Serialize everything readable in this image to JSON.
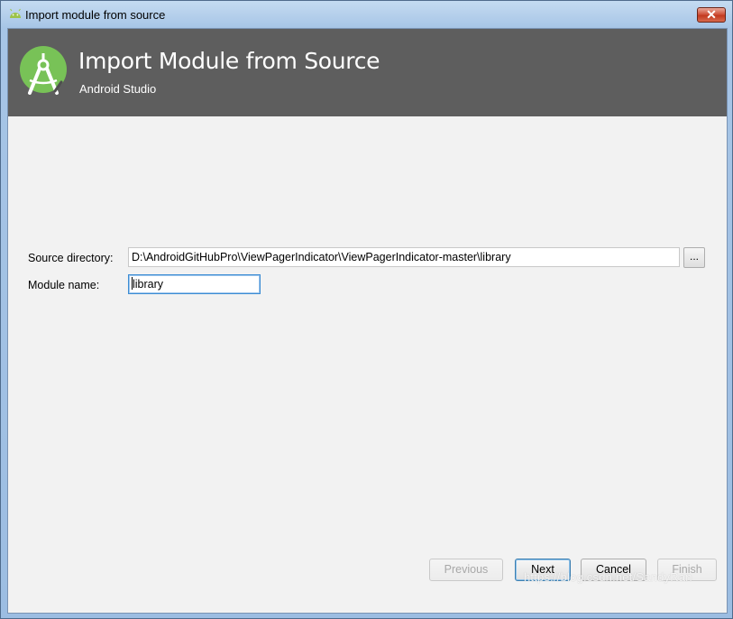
{
  "window": {
    "title": "Import module from source",
    "close_glyph": "✕"
  },
  "header": {
    "title": "Import Module from Source",
    "subtitle": "Android Studio",
    "logo_icon": "android-studio-icon",
    "header_bg": "#5e5e5e",
    "logo_green": "#78c257"
  },
  "form": {
    "source_label": "Source directory:",
    "source_value": "D:\\AndroidGitHubPro\\ViewPagerIndicator\\ViewPagerIndicator-master\\library",
    "browse_label": "...",
    "module_label": "Module name:",
    "module_value": "library"
  },
  "buttons": {
    "previous": "Previous",
    "next": "Next",
    "cancel": "Cancel",
    "finish": "Finish"
  },
  "watermark": "https://blog.csdn.net/SandyRan"
}
